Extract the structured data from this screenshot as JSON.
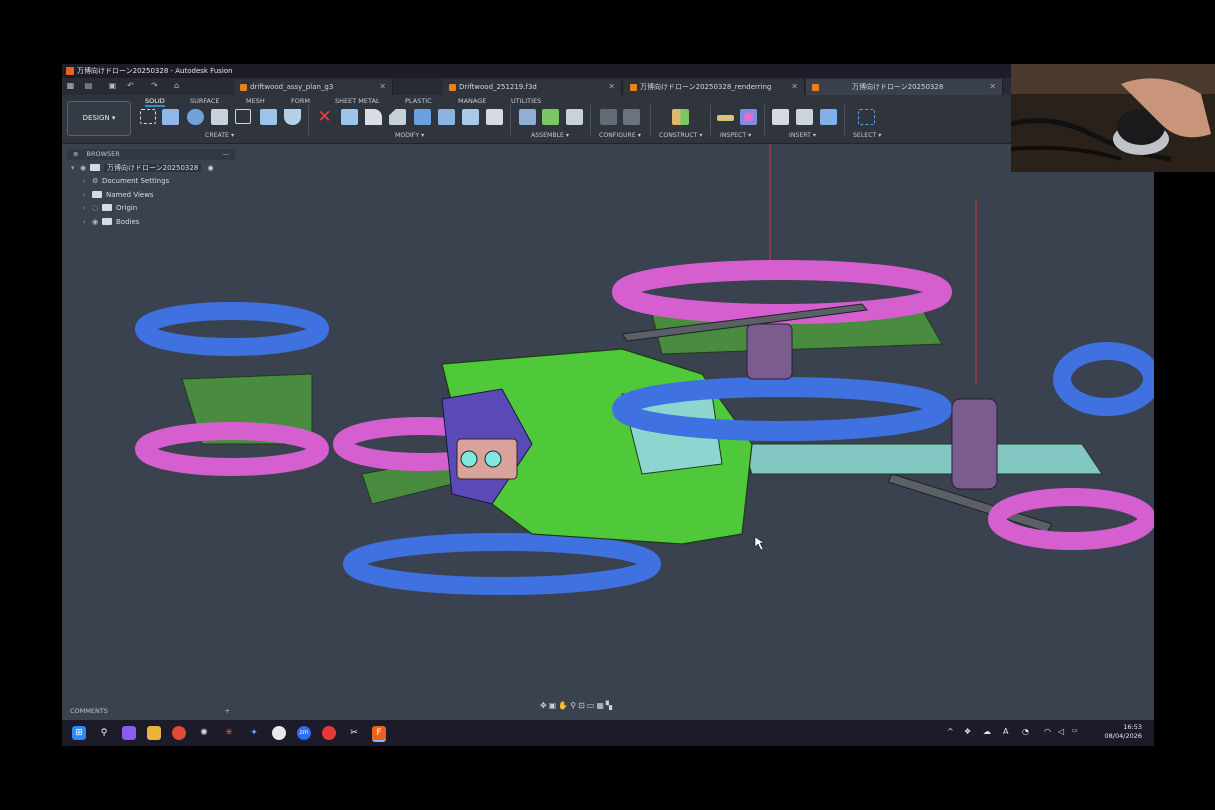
{
  "window": {
    "title": "万博向けドローン20250328 - Autodesk Fusion"
  },
  "tabs": [
    {
      "label": "driftwood_assy_plan_g3",
      "active": false
    },
    {
      "label": "Driftwood_251219.f3d",
      "active": false
    },
    {
      "label": "万博向けドローン20250328_renderring",
      "active": false
    },
    {
      "label": "万博向けドローン20250328",
      "active": true
    }
  ],
  "toolbar": {
    "workspace_label": "DESIGN",
    "workspace_tabs": [
      "SOLID",
      "SURFACE",
      "MESH",
      "FORM",
      "SHEET METAL",
      "PLASTIC",
      "MANAGE",
      "UTILITIES"
    ],
    "groups": [
      "CREATE",
      "MODIFY",
      "ASSEMBLE",
      "CONFIGURE",
      "CONSTRUCT",
      "INSPECT",
      "INSERT",
      "SELECT"
    ]
  },
  "browser": {
    "header": "BROWSER",
    "root": "万博向けドローン20250328",
    "items": [
      "Document Settings",
      "Named Views",
      "Origin",
      "Bodies"
    ]
  },
  "comments": {
    "label": "COMMENTS"
  },
  "taskbar": {
    "time": "16:53",
    "date": "08/04/2026"
  },
  "colors": {
    "canvas": "#3a4250",
    "drone_body": "#4fc93a",
    "guard_blue": "#3f72e0",
    "guard_pink": "#d65fd0",
    "motor": "#7a5d8e",
    "accent": "#e8631c"
  }
}
